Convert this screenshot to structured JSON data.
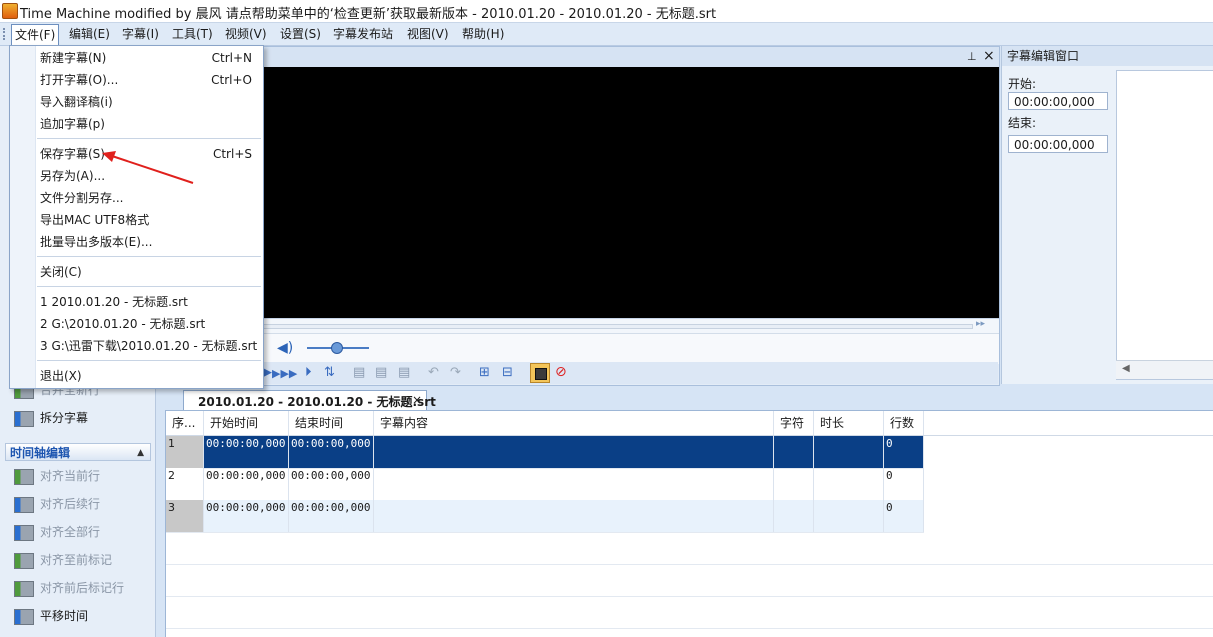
{
  "window": {
    "title": "Time Machine modified by 晨风 请点帮助菜单中的‘检查更新’获取最新版本 - 2010.01.20 - 2010.01.20 - 无标题.srt"
  },
  "menubar": [
    {
      "label": "文件(F)"
    },
    {
      "label": "编辑(E)"
    },
    {
      "label": "字幕(I)"
    },
    {
      "label": "工具(T)"
    },
    {
      "label": "视频(V)"
    },
    {
      "label": "设置(S)"
    },
    {
      "label": "字幕发布站"
    },
    {
      "label": "视图(V)"
    },
    {
      "label": "帮助(H)"
    }
  ],
  "file_menu": {
    "groups": [
      [
        {
          "label": "新建字幕(N)",
          "shortcut": "Ctrl+N"
        },
        {
          "label": "打开字幕(O)...",
          "shortcut": "Ctrl+O"
        },
        {
          "label": "导入翻译稿(i)",
          "shortcut": ""
        },
        {
          "label": "追加字幕(p)",
          "shortcut": ""
        }
      ],
      [
        {
          "label": "保存字幕(S)",
          "shortcut": "Ctrl+S"
        },
        {
          "label": "另存为(A)...",
          "shortcut": ""
        },
        {
          "label": "文件分割另存...",
          "shortcut": ""
        },
        {
          "label": "导出MAC UTF8格式",
          "shortcut": ""
        },
        {
          "label": "批量导出多版本(E)...",
          "shortcut": ""
        }
      ],
      [
        {
          "label": "关闭(C)",
          "shortcut": ""
        }
      ],
      [
        {
          "label": "1 2010.01.20 - 无标题.srt",
          "shortcut": ""
        },
        {
          "label": "2 G:\\2010.01.20 - 无标题.srt",
          "shortcut": ""
        },
        {
          "label": "3 G:\\迅雷下载\\2010.01.20 - 无标题.srt",
          "shortcut": ""
        }
      ],
      [
        {
          "label": "退出(X)",
          "shortcut": ""
        }
      ]
    ]
  },
  "left_panel": {
    "items_top": [
      {
        "label": "合并全新行",
        "disabled": true
      },
      {
        "label": "拆分字幕",
        "disabled": false
      }
    ],
    "section_title": "时间轴编辑",
    "section_items": [
      {
        "label": "对齐当前行",
        "disabled": true
      },
      {
        "label": "对齐后续行",
        "disabled": true
      },
      {
        "label": "对齐全部行",
        "disabled": true
      },
      {
        "label": "对齐至前标记",
        "disabled": true
      },
      {
        "label": "对齐前后标记行",
        "disabled": true
      },
      {
        "label": "平移时间",
        "disabled": false
      }
    ]
  },
  "editor_panel": {
    "title": "字幕编辑窗口",
    "start_label": "开始:",
    "start_value": "00:00:00,000",
    "end_label": "结束:",
    "end_value": "00:00:00,000"
  },
  "document_tab": {
    "label": "2010.01.20 - 2010.01.20 - 无标题.srt"
  },
  "grid": {
    "columns": [
      "序...",
      "开始时间",
      "结束时间",
      "字幕内容",
      "字符",
      "时长",
      "行数"
    ],
    "rows": [
      {
        "seq": "1",
        "start": "00:00:00,000",
        "end": "00:00:00,000",
        "text": "",
        "chars": "",
        "duration": "",
        "lines": "0"
      },
      {
        "seq": "2",
        "start": "00:00:00,000",
        "end": "00:00:00,000",
        "text": "",
        "chars": "",
        "duration": "",
        "lines": "0"
      },
      {
        "seq": "3",
        "start": "00:00:00,000",
        "end": "00:00:00,000",
        "text": "",
        "chars": "",
        "duration": "",
        "lines": "0"
      }
    ]
  },
  "colors": {
    "selection": "#0a3f86",
    "annotation_arrow": "#e0201c",
    "accent": "#1d55b0"
  }
}
